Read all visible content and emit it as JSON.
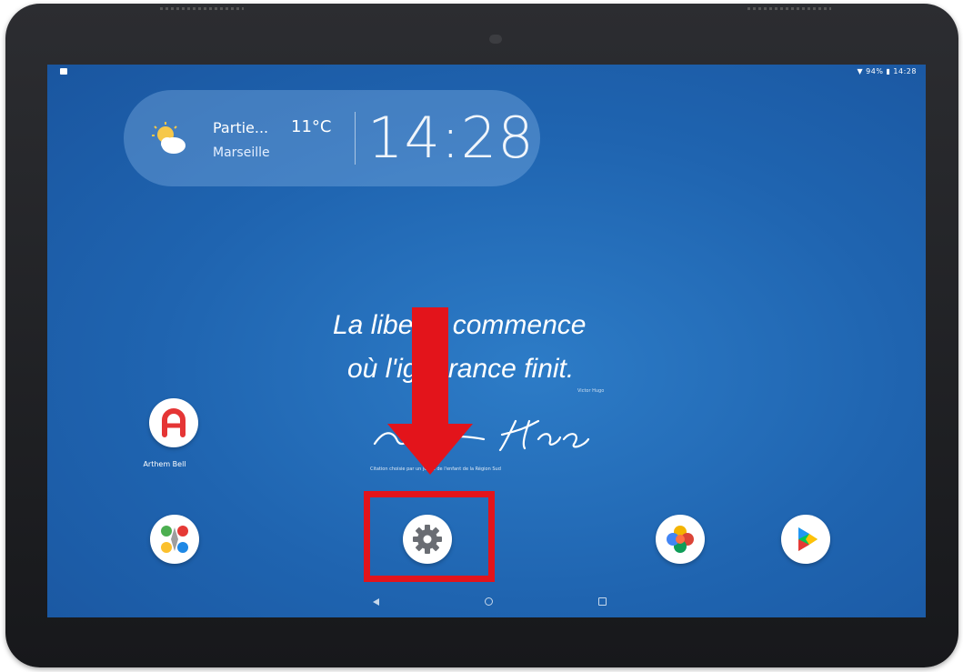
{
  "status_bar": {
    "right_text": "▼ 94% ▮ 14:28"
  },
  "weather_widget": {
    "description": "Partie...",
    "temperature": "11°C",
    "city": "Marseille",
    "time": "14:28"
  },
  "wallpaper": {
    "quote_line1": "La liberté commence",
    "quote_line2": "où l'ignorance finit.",
    "author": "Victor Hugo",
    "credit": "Citation choisie par un jeune de l'enfant de la Région Sud"
  },
  "apps": [
    {
      "name": "Arthem Bell",
      "icon": "a-red-logo-icon"
    },
    {
      "name": "",
      "icon": "compass-apps-icon"
    },
    {
      "name": "",
      "icon": "settings-gear-icon"
    },
    {
      "name": "",
      "icon": "colorful-flower-icon"
    },
    {
      "name": "",
      "icon": "play-store-icon"
    }
  ],
  "annotation": {
    "color": "#e3141b",
    "target": "settings"
  },
  "colors": {
    "screen": "#1f64b0",
    "bezel": "#202125",
    "accent_red": "#e3141b"
  }
}
